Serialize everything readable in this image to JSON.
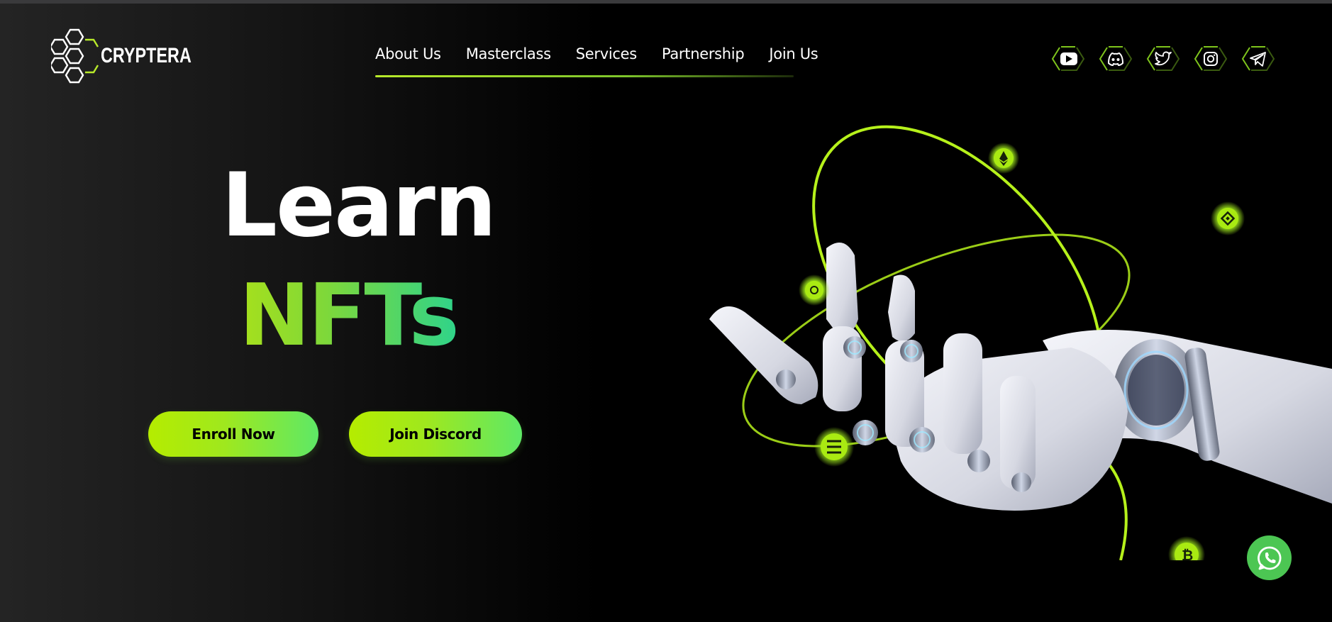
{
  "brand": {
    "name": "CRYPTERA",
    "accent": "#b8ea2a"
  },
  "nav": {
    "items": [
      {
        "label": "About Us",
        "active": true
      },
      {
        "label": "Masterclass"
      },
      {
        "label": "Services"
      },
      {
        "label": "Partnership"
      },
      {
        "label": "Join Us"
      }
    ]
  },
  "social": {
    "icons": [
      "youtube-icon",
      "discord-icon",
      "twitter-icon",
      "instagram-icon",
      "telegram-icon"
    ]
  },
  "hero": {
    "title_line1": "Learn",
    "title_line2": "NFTs",
    "enroll_label": "Enroll Now",
    "discord_label": "Join Discord"
  },
  "floating": {
    "whatsapp_icon": "whatsapp-icon"
  },
  "colors": {
    "background": "#000000",
    "button_start": "#b5ec00",
    "button_end": "#5ee866",
    "nfts_start": "#a7e01c",
    "nfts_end": "#2fd38a",
    "whatsapp": "#4cc653"
  }
}
